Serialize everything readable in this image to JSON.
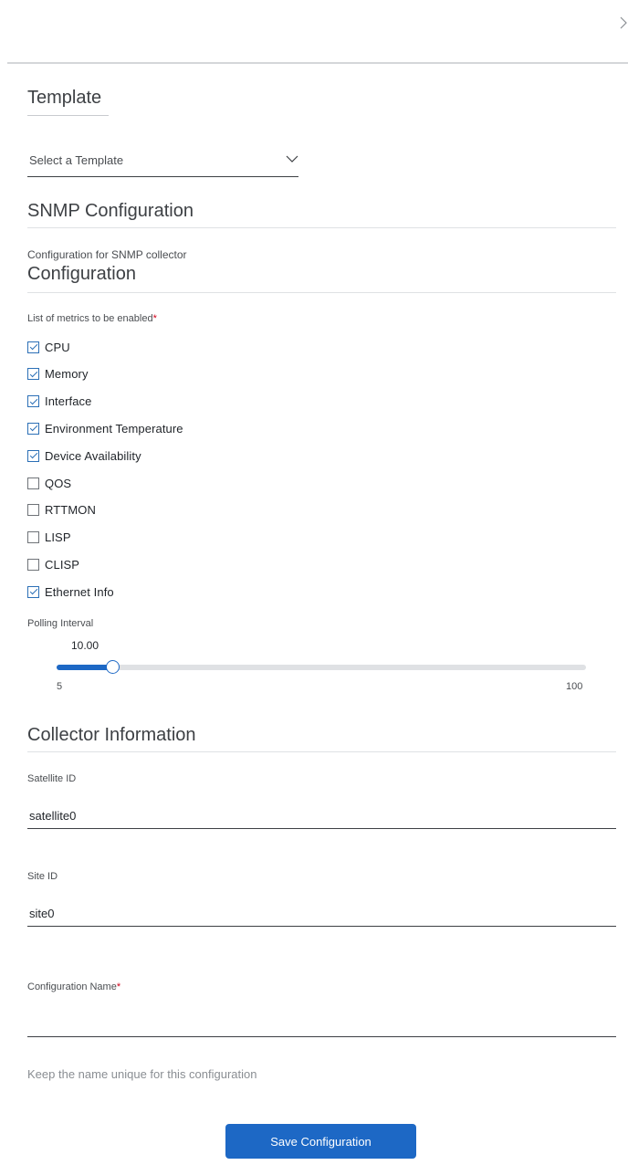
{
  "icons": {
    "close": "chevron-right-icon",
    "select": "chevron-down-icon",
    "checkbox": "checkmark-icon"
  },
  "colors": {
    "accent": "#1d68c5",
    "required": "#d0021b",
    "hint": "#8a8e93"
  },
  "template": {
    "title": "Template",
    "select_value": "Select a Template"
  },
  "snmp": {
    "title": "SNMP Configuration",
    "subtitle": "Configuration for SNMP collector"
  },
  "configuration": {
    "title": "Configuration",
    "metrics_label": "List of metrics to be enabled",
    "required_mark": "*",
    "metrics": [
      {
        "label": "CPU",
        "checked": true
      },
      {
        "label": "Memory",
        "checked": true
      },
      {
        "label": "Interface",
        "checked": true
      },
      {
        "label": "Environment Temperature",
        "checked": true
      },
      {
        "label": "Device Availability",
        "checked": true
      },
      {
        "label": "QOS",
        "checked": false
      },
      {
        "label": "RTTMON",
        "checked": false
      },
      {
        "label": "LISP",
        "checked": false
      },
      {
        "label": "CLISP",
        "checked": false
      },
      {
        "label": "Ethernet Info",
        "checked": true
      }
    ]
  },
  "polling": {
    "label": "Polling Interval",
    "value_text": "10.00",
    "value": 10,
    "min_label": "5",
    "max_label": "100",
    "min": 5,
    "max": 100
  },
  "collector": {
    "title": "Collector Information",
    "satellite_label": "Satellite ID",
    "satellite_value": "satellite0",
    "site_label": "Site ID",
    "site_value": "site0",
    "name_label": "Configuration Name",
    "name_required": "*",
    "name_value": "",
    "hint": "Keep the name unique for this configuration"
  },
  "actions": {
    "save_label": "Save Configuration"
  }
}
